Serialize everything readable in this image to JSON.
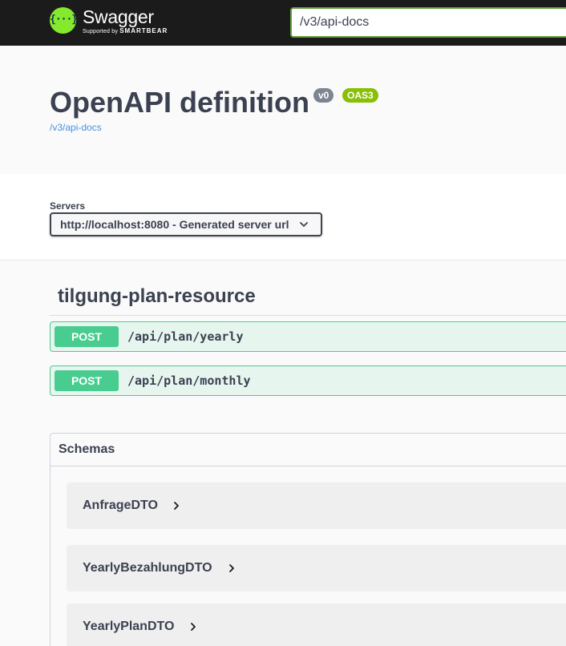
{
  "topbar": {
    "logo_mark": "{···}",
    "logo_title": "Swagger",
    "logo_sub_prefix": "Supported by",
    "logo_sub_brand": "SMARTBEAR",
    "url_value": "/v3/api-docs"
  },
  "info": {
    "title": "OpenAPI definition",
    "version_badge": "v0",
    "oas_badge": "OAS3",
    "link": "/v3/api-docs"
  },
  "servers": {
    "label": "Servers",
    "selected": "http://localhost:8080 - Generated server url"
  },
  "tag": {
    "title": "tilgung-plan-resource",
    "operations": [
      {
        "method": "POST",
        "path": "/api/plan/yearly"
      },
      {
        "method": "POST",
        "path": "/api/plan/monthly"
      }
    ]
  },
  "schemas": {
    "header": "Schemas",
    "models": [
      {
        "name": "AnfrageDTO"
      },
      {
        "name": "YearlyBezahlungDTO"
      },
      {
        "name": "YearlyPlanDTO"
      }
    ]
  },
  "colors": {
    "topbar_bg": "#1b1b1b",
    "logo_green": "#85ea2d",
    "post_green": "#49cc90",
    "version_badge": "#7d8492",
    "oas_badge": "#89bf04",
    "link_blue": "#4990e2",
    "text": "#3b4151"
  }
}
